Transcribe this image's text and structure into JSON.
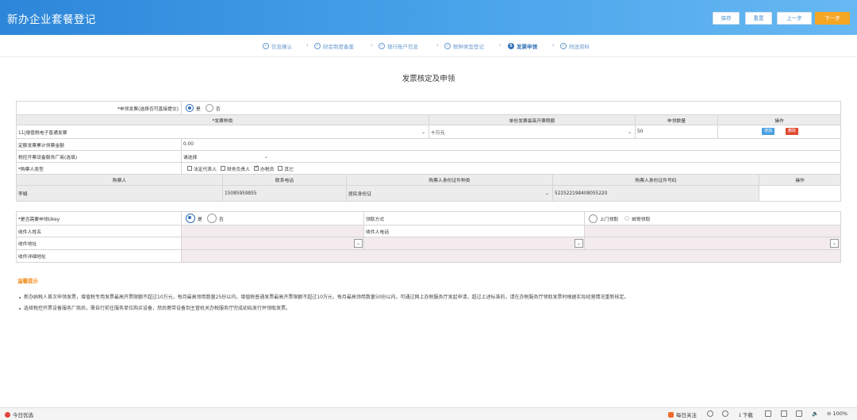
{
  "header": {
    "title": "新办企业套餐登记",
    "buttons": {
      "save": "保存",
      "reset": "重置",
      "prev": "上一步",
      "next": "下一步"
    }
  },
  "steps": [
    {
      "label": "信息确认",
      "icon": "check-circle-icon",
      "num": ""
    },
    {
      "label": "财会制度备案",
      "icon": "check-circle-icon",
      "num": ""
    },
    {
      "label": "银行账户信息",
      "icon": "check-circle-icon",
      "num": ""
    },
    {
      "label": "税种类型登记",
      "icon": "check-circle-icon",
      "num": ""
    },
    {
      "label": "发票申领",
      "icon": "step-number-icon",
      "num": "5"
    },
    {
      "label": "附送资料",
      "icon": "check-circle-icon",
      "num": ""
    }
  ],
  "section_title": "发票核定及申领",
  "invoice_form": {
    "apply_label": "*申领发票(选择否可直接提交)",
    "yes": "是",
    "no": "否",
    "headers": {
      "type": "*发票种类",
      "limit": "单份发票最高开票限额",
      "qty": "申领数量",
      "op": "操作"
    },
    "row": {
      "type": "11|增值税电子普通发票",
      "limit": "十万元",
      "qty": "50",
      "add": "增加",
      "delete": "删除"
    },
    "amount_label": "定额发票累计领票金额",
    "amount_value": "0.00",
    "vendor_label": "税控开票设备服务厂商(选填)",
    "vendor_value": "请选择",
    "buyer_type_label": "*购票人类型",
    "buyer_types": [
      {
        "label": "法定代表人",
        "checked": false
      },
      {
        "label": "财务负责人",
        "checked": false
      },
      {
        "label": "办税员",
        "checked": true
      },
      {
        "label": "其它",
        "checked": false
      }
    ],
    "buyer_headers": {
      "name": "购票人",
      "phone": "联系电话",
      "id_type": "购票人身份证件种类",
      "id_no": "购票人身份证件号码",
      "op": "操作"
    },
    "buyer_row": {
      "name": "李娟",
      "phone": "15085959855",
      "id_type": "居民身份证",
      "id_no": "522522198408055220"
    }
  },
  "ukey_form": {
    "need_label": "*是否需要申领Ukey",
    "yes": "是",
    "no": "否",
    "method_label": "领取方式",
    "method_options": [
      "上门领取",
      "邮寄领取"
    ],
    "recipient_label": "收件人姓名",
    "recipient_phone_label": "收件人电话",
    "address_label": "收件地址",
    "address_detail_label": "收件详细地址"
  },
  "tips": {
    "title": "温馨提示",
    "items": [
      "新办纳税人首次申领发票，增值税专用发票最高开票限额不超过10万元，每月最高领用数量25份以内，增值税普通发票最高开票限额不超过10万元，每月最高领用数量50份以内。可通过网上办税服务厅发起申请，超过上述标准的，请在办税服务厅领取发票时根据实际经营情况重新核定。",
      "选择税控开票设备服务厂商后，需自行前往服务单位购买设备，然后携带设备到主管机关办税服务厅完成初始发行并领取发票。"
    ]
  },
  "statusbar": {
    "left": "今日优选",
    "hot": "每日关注",
    "download": "下载",
    "zoom": "100%"
  },
  "colors": {
    "header": "#3a95e0",
    "accent": "#2f6fb5",
    "next": "#f5a623",
    "delete": "#e04a2f",
    "add": "#4a9fe0"
  }
}
